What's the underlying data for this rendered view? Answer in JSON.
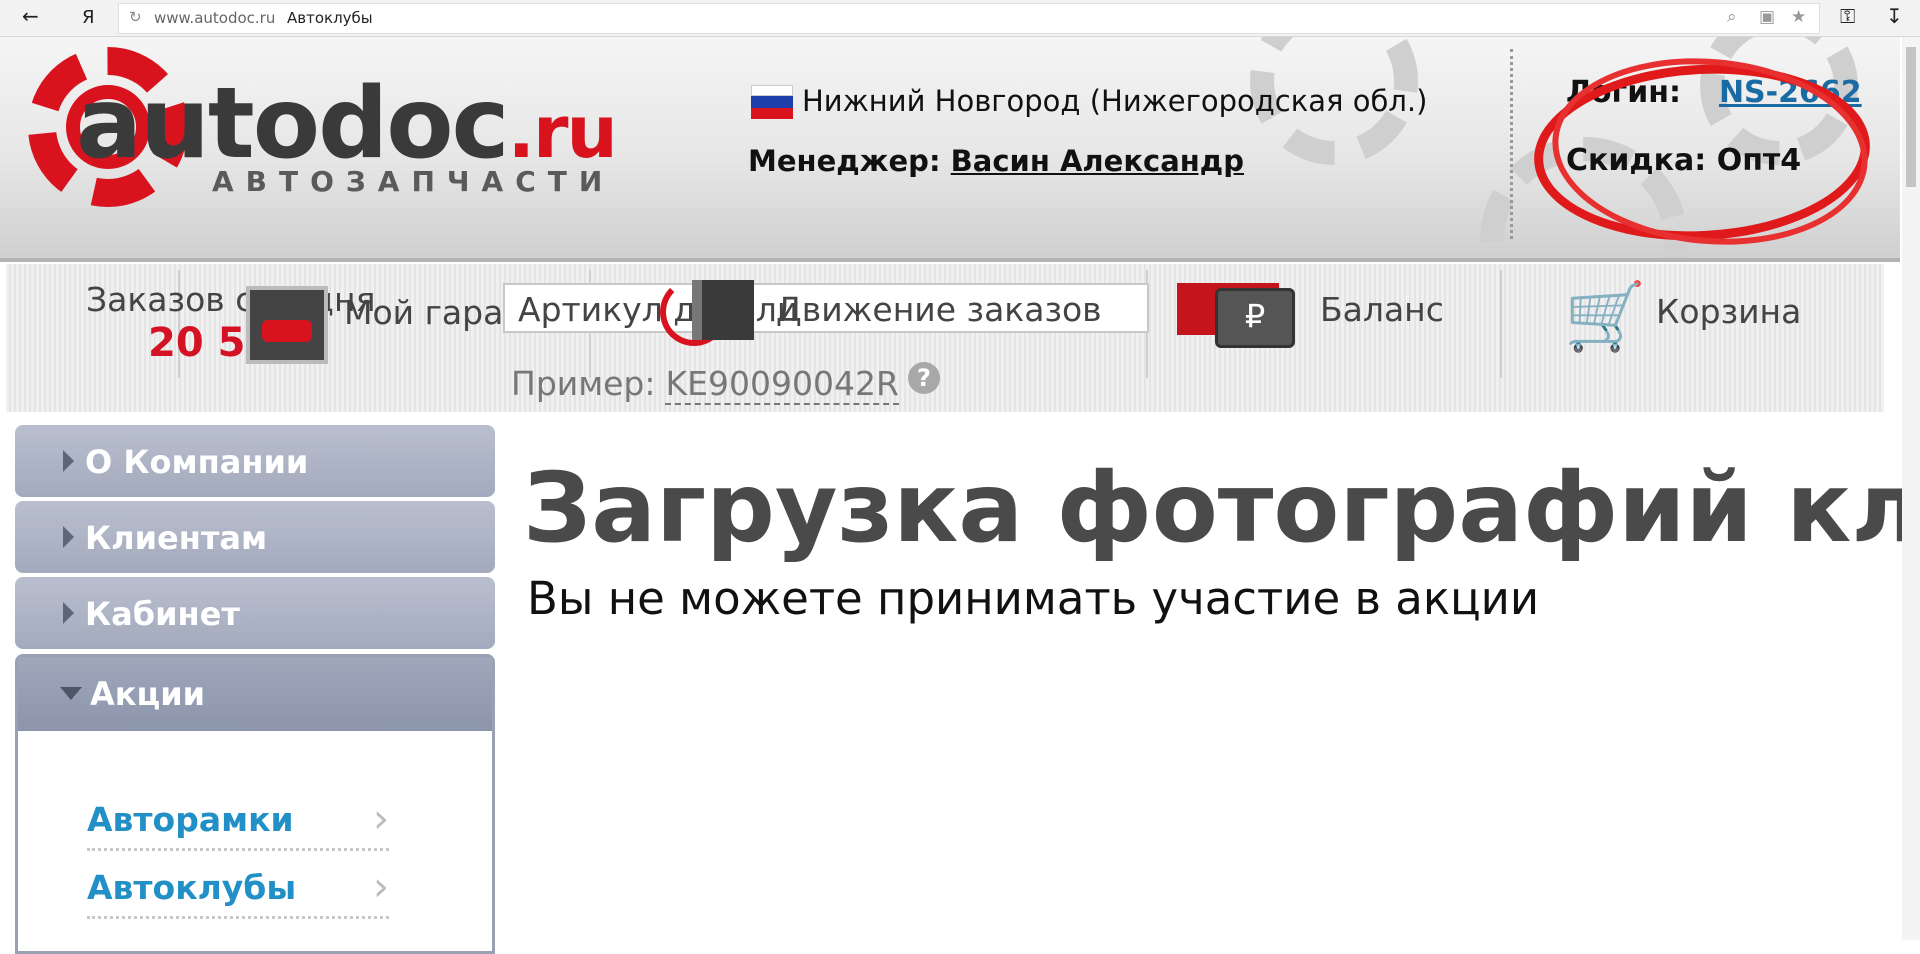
{
  "browser": {
    "url": "www.autodoc.ru",
    "page_title": "Автоклубы",
    "yandex_label": "Я"
  },
  "header": {
    "logo_text": "autodoc",
    "logo_domain": ".ru",
    "logo_subtitle": "АВТОЗАПЧАСТИ",
    "city": "Нижний Новгород (Нижегородская обл.)",
    "manager_label": "Менеджер:",
    "manager_name": "Васин Александр",
    "login_label": "Логин:",
    "login_value": "NS-2662",
    "discount_label": "Скидка:",
    "discount_value": "Опт4",
    "flag_colors": [
      "#ffffff",
      "#1c3faa",
      "#d8131e"
    ],
    "annotation_color": "#e01a1a"
  },
  "toolbar": {
    "orders_today_label": "Заказов сегодня",
    "orders_today_count": "20 5",
    "garage_label": "Мой гараж",
    "search_placeholder": "Артикул детали",
    "order_movement_label": "Движение заказов",
    "balance_label": "Баланс",
    "cart_label": "Корзина",
    "example_label": "Пример:",
    "example_value": "KE90090042R",
    "help_glyph": "?"
  },
  "sidebar": {
    "items": [
      {
        "label": "О Компании"
      },
      {
        "label": "Клиентам"
      },
      {
        "label": "Кабинет"
      }
    ],
    "open_section": {
      "label": "Акции",
      "subitems": [
        {
          "label": "Авторамки"
        },
        {
          "label": "Автоклубы"
        }
      ]
    }
  },
  "main": {
    "title": "Загрузка фотографий кл",
    "message": "Вы не можете принимать участие в акции"
  }
}
